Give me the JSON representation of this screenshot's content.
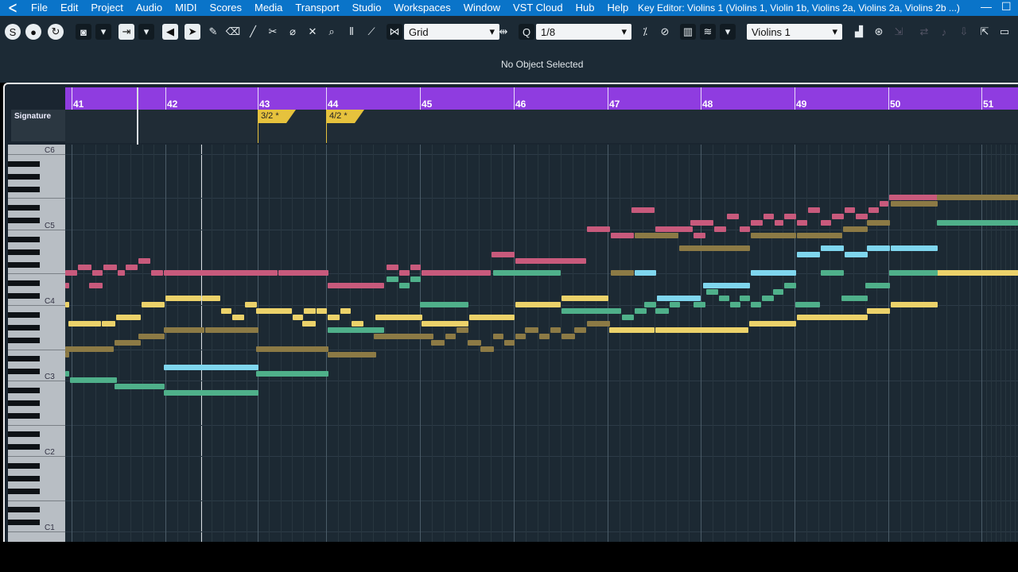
{
  "menubar": {
    "logo": "ᐸ",
    "items": [
      "File",
      "Edit",
      "Project",
      "Audio",
      "MIDI",
      "Scores",
      "Media",
      "Transport",
      "Studio",
      "Workspaces",
      "Window",
      "VST Cloud",
      "Hub",
      "Help"
    ],
    "title": "Key Editor: Violins 1 (Violins 1, Violin 1b, Violins 2a, Violins 2a, Violins 2b ...)",
    "minimize": "—",
    "maximize": "☐"
  },
  "toolbar": {
    "snap_type": "Grid",
    "quantize": "1/8",
    "track": "Violins 1",
    "icons": [
      "solo-icon",
      "record-icon",
      "loop-icon",
      "camera-icon",
      "dropdown-icon",
      "split-icon",
      "dropdown-icon",
      "speaker-icon",
      "arrow-select-icon",
      "pencil-icon",
      "eraser-icon",
      "brush-icon",
      "scissors-icon",
      "glue-icon",
      "mute-icon",
      "zoom-icon",
      "comp-icon",
      "line-icon",
      "snap-icon",
      "snap-mode-icon",
      "quantize-icon",
      "iterative-quantize-icon",
      "chord-icon",
      "stack-icon",
      "velocity-icon",
      "drum-icon",
      "search-icon"
    ]
  },
  "infobar": {
    "status": "No Object Selected"
  },
  "ruler": {
    "bars": [
      "41",
      "42",
      "43",
      "44",
      "45",
      "46",
      "47",
      "48",
      "49",
      "50",
      "51"
    ]
  },
  "signature": {
    "lane_label": "Signature",
    "markers": [
      {
        "label": "3/2",
        "bar": 43
      },
      {
        "label": "4/2",
        "bar": 44
      }
    ]
  },
  "keyboard": {
    "labels": [
      "C6",
      "C5",
      "C4",
      "C3",
      "C2",
      "C1"
    ]
  },
  "colors": {
    "pink": "#c85a7c",
    "yellow": "#ecd26a",
    "olive": "#8c7a45",
    "teal": "#4fb08a",
    "cyan": "#7fd6ee",
    "ruler": "#8f3ce0"
  }
}
